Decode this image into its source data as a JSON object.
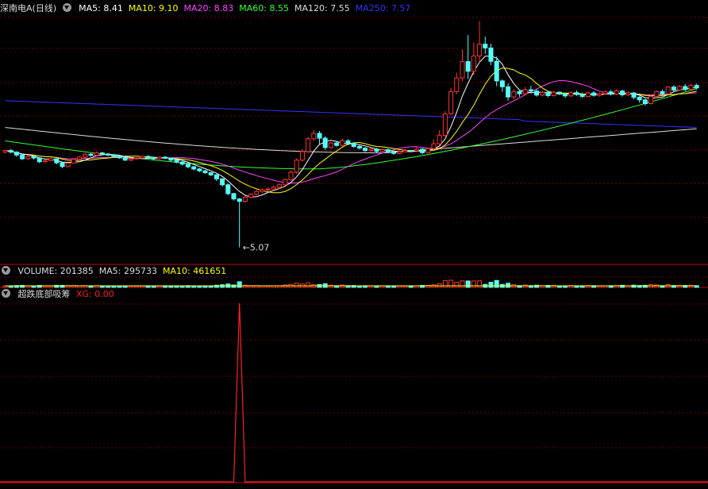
{
  "stock_title": "深南电A(日线)",
  "main_indicators": [
    {
      "label": "MA5: 8.41",
      "color": "#ffffff"
    },
    {
      "label": "MA10: 9.10",
      "color": "#ffff00"
    },
    {
      "label": "MA20: 8.83",
      "color": "#ff44ff"
    },
    {
      "label": "MA60: 8.55",
      "color": "#33ff33"
    },
    {
      "label": "MA120: 7.55",
      "color": "#dddddd"
    },
    {
      "label": "MA250: 7.57",
      "color": "#3333ff"
    }
  ],
  "low_marker": "←5.07",
  "volume_indicators": [
    {
      "label": "VOLUME: 201385",
      "color": "#dddddd"
    },
    {
      "label": "MA5: 295733",
      "color": "#dddddd"
    },
    {
      "label": "MA10: 461651",
      "color": "#ffff00"
    }
  ],
  "indicator_name": "超跌底部吸筹",
  "indicator_value": "XG: 0.00",
  "colors": {
    "up": "#ff3232",
    "down": "#54ffff",
    "grid": "#7a0000",
    "frame": "#c00000",
    "signal": "#ff2020"
  },
  "chart_data": {
    "type": "candlestick",
    "title": "",
    "candles": [
      [
        8.63,
        8.69,
        8.58,
        8.7
      ],
      [
        8.69,
        8.63,
        8.58,
        8.75
      ],
      [
        8.63,
        8.52,
        8.45,
        8.66
      ],
      [
        8.52,
        8.38,
        8.33,
        8.55
      ],
      [
        8.38,
        8.47,
        8.34,
        8.52
      ],
      [
        8.47,
        8.41,
        8.35,
        8.5
      ],
      [
        8.41,
        8.27,
        8.22,
        8.44
      ],
      [
        8.27,
        8.31,
        8.22,
        8.36
      ],
      [
        8.31,
        8.38,
        8.29,
        8.41
      ],
      [
        8.38,
        8.23,
        8.17,
        8.4
      ],
      [
        8.23,
        8.09,
        8.03,
        8.26
      ],
      [
        8.09,
        8.22,
        8.06,
        8.25
      ],
      [
        8.22,
        8.36,
        8.21,
        8.4
      ],
      [
        8.36,
        8.44,
        8.3,
        8.49
      ],
      [
        8.44,
        8.55,
        8.41,
        8.6
      ],
      [
        8.55,
        8.51,
        8.47,
        8.59
      ],
      [
        8.51,
        8.6,
        8.48,
        8.66
      ],
      [
        8.6,
        8.56,
        8.51,
        8.64
      ],
      [
        8.56,
        8.52,
        8.48,
        8.6
      ],
      [
        8.52,
        8.47,
        8.42,
        8.56
      ],
      [
        8.47,
        8.42,
        8.38,
        8.5
      ],
      [
        8.42,
        8.33,
        8.3,
        8.46
      ],
      [
        8.33,
        8.38,
        8.29,
        8.41
      ],
      [
        8.38,
        8.41,
        8.34,
        8.44
      ],
      [
        8.41,
        8.47,
        8.38,
        8.5
      ],
      [
        8.47,
        8.43,
        8.39,
        8.51
      ],
      [
        8.43,
        8.38,
        8.33,
        8.46
      ],
      [
        8.38,
        8.44,
        8.35,
        8.47
      ],
      [
        8.44,
        8.4,
        8.36,
        8.48
      ],
      [
        8.4,
        8.33,
        8.28,
        8.43
      ],
      [
        8.33,
        8.26,
        8.21,
        8.37
      ],
      [
        8.26,
        8.18,
        8.13,
        8.3
      ],
      [
        8.18,
        8.08,
        8.03,
        8.22
      ],
      [
        8.08,
        8.0,
        7.94,
        8.11
      ],
      [
        8.0,
        7.93,
        7.88,
        8.04
      ],
      [
        7.93,
        7.86,
        7.82,
        7.97
      ],
      [
        7.86,
        7.78,
        7.73,
        7.89
      ],
      [
        7.78,
        7.63,
        7.55,
        7.81
      ],
      [
        7.63,
        7.41,
        7.34,
        7.66
      ],
      [
        7.41,
        7.08,
        7.01,
        7.45
      ],
      [
        7.08,
        6.88,
        6.82,
        7.11
      ],
      [
        6.88,
        6.79,
        5.07,
        6.92
      ],
      [
        6.79,
        6.94,
        6.74,
        7.0
      ],
      [
        6.94,
        7.05,
        6.9,
        7.1
      ],
      [
        7.05,
        7.16,
        7.01,
        7.22
      ],
      [
        7.16,
        7.22,
        7.1,
        7.28
      ],
      [
        7.22,
        7.25,
        7.16,
        7.32
      ],
      [
        7.25,
        7.32,
        7.2,
        7.38
      ],
      [
        7.32,
        7.41,
        7.26,
        7.45
      ],
      [
        7.41,
        7.6,
        7.38,
        7.65
      ],
      [
        7.6,
        7.88,
        7.56,
        7.95
      ],
      [
        7.88,
        8.33,
        7.82,
        8.4
      ],
      [
        8.33,
        8.65,
        8.27,
        8.74
      ],
      [
        8.65,
        9.13,
        8.6,
        9.2
      ],
      [
        9.13,
        9.33,
        9.05,
        9.47
      ],
      [
        9.33,
        9.15,
        8.92,
        9.42
      ],
      [
        9.15,
        8.8,
        8.71,
        9.22
      ],
      [
        8.8,
        8.97,
        8.76,
        9.02
      ],
      [
        8.97,
        8.88,
        8.83,
        9.05
      ],
      [
        8.88,
        9.05,
        8.84,
        9.14
      ],
      [
        9.05,
        8.96,
        8.88,
        9.11
      ],
      [
        8.96,
        8.84,
        8.79,
        9.0
      ],
      [
        8.84,
        8.78,
        8.72,
        8.9
      ],
      [
        8.78,
        8.69,
        8.63,
        8.82
      ],
      [
        8.69,
        8.74,
        8.64,
        8.79
      ],
      [
        8.74,
        8.66,
        8.61,
        8.78
      ],
      [
        8.66,
        8.72,
        8.63,
        8.77
      ],
      [
        8.72,
        8.64,
        8.6,
        8.76
      ],
      [
        8.64,
        8.58,
        8.53,
        8.68
      ],
      [
        8.58,
        8.64,
        8.55,
        8.7
      ],
      [
        8.64,
        8.69,
        8.61,
        8.74
      ],
      [
        8.69,
        8.68,
        8.66,
        8.7
      ],
      [
        8.68,
        8.74,
        8.63,
        8.81
      ],
      [
        8.74,
        8.61,
        8.55,
        8.78
      ],
      [
        8.61,
        8.76,
        8.58,
        8.8
      ],
      [
        8.76,
        8.94,
        8.72,
        9.1
      ],
      [
        8.94,
        9.26,
        8.9,
        9.45
      ],
      [
        9.26,
        10.06,
        9.2,
        10.17
      ],
      [
        10.06,
        10.89,
        10.0,
        11.03
      ],
      [
        10.89,
        11.4,
        10.8,
        11.6
      ],
      [
        11.4,
        12.01,
        11.28,
        12.46
      ],
      [
        12.01,
        11.65,
        11.36,
        13.0
      ],
      [
        11.65,
        12.22,
        11.5,
        12.72
      ],
      [
        12.22,
        12.66,
        11.98,
        13.52
      ],
      [
        12.66,
        12.52,
        12.3,
        12.94
      ],
      [
        12.52,
        12.02,
        11.88,
        12.68
      ],
      [
        12.02,
        11.29,
        11.09,
        12.2
      ],
      [
        11.29,
        11.07,
        10.88,
        11.35
      ],
      [
        11.07,
        10.69,
        10.55,
        11.2
      ],
      [
        10.69,
        10.89,
        10.6,
        10.98
      ],
      [
        10.89,
        10.81,
        10.7,
        10.95
      ],
      [
        10.81,
        10.96,
        10.74,
        11.07
      ],
      [
        10.96,
        10.91,
        10.82,
        11.11
      ],
      [
        10.91,
        10.76,
        10.7,
        10.98
      ],
      [
        10.76,
        10.86,
        10.71,
        10.92
      ],
      [
        10.86,
        10.74,
        10.68,
        10.93
      ],
      [
        10.74,
        10.87,
        10.7,
        10.92
      ],
      [
        10.87,
        10.8,
        10.76,
        10.88
      ],
      [
        10.8,
        10.73,
        10.66,
        10.85
      ],
      [
        10.73,
        10.85,
        10.69,
        10.9
      ],
      [
        10.85,
        10.78,
        10.73,
        10.93
      ],
      [
        10.78,
        10.71,
        10.65,
        10.86
      ],
      [
        10.71,
        10.84,
        10.68,
        10.89
      ],
      [
        10.84,
        10.75,
        10.7,
        10.91
      ],
      [
        10.75,
        10.81,
        10.7,
        10.86
      ],
      [
        10.81,
        10.88,
        10.77,
        10.93
      ],
      [
        10.88,
        10.8,
        10.74,
        10.95
      ],
      [
        10.8,
        10.91,
        10.76,
        10.98
      ],
      [
        10.91,
        10.77,
        10.7,
        10.96
      ],
      [
        10.77,
        10.84,
        10.72,
        10.9
      ],
      [
        10.84,
        10.68,
        10.6,
        10.88
      ],
      [
        10.68,
        10.58,
        10.47,
        10.72
      ],
      [
        10.58,
        10.44,
        10.37,
        10.63
      ],
      [
        10.44,
        10.71,
        10.41,
        10.78
      ],
      [
        10.71,
        10.89,
        10.66,
        10.94
      ],
      [
        10.89,
        10.8,
        10.74,
        10.96
      ],
      [
        10.8,
        11.06,
        10.77,
        11.1
      ],
      [
        11.06,
        10.95,
        10.89,
        11.12
      ],
      [
        10.95,
        11.08,
        10.9,
        11.14
      ],
      [
        11.08,
        10.97,
        10.91,
        11.17
      ],
      [
        10.97,
        11.12,
        10.93,
        11.18
      ],
      [
        11.12,
        11.03,
        10.97,
        11.19
      ]
    ],
    "xg_values": [
      0,
      0,
      0,
      0,
      0,
      0,
      0,
      0,
      0,
      0,
      0,
      0,
      0,
      0,
      0,
      0,
      0,
      0,
      0,
      0,
      0,
      0,
      0,
      0,
      0,
      0,
      0,
      0,
      0,
      0,
      0,
      0,
      0,
      0,
      0,
      0,
      0,
      0,
      0,
      0,
      0,
      1,
      0,
      0,
      0,
      0,
      0,
      0,
      0,
      0,
      0,
      0,
      0,
      0,
      0,
      0,
      0,
      0,
      0,
      0,
      0,
      0,
      0,
      0,
      0,
      0,
      0,
      0,
      0,
      0,
      0,
      0,
      0,
      0,
      0,
      0,
      0,
      0,
      0,
      0,
      0,
      0,
      0,
      0,
      0,
      0,
      0,
      0,
      0,
      0,
      0,
      0,
      0,
      0,
      0,
      0,
      0,
      0,
      0,
      0,
      0,
      0,
      0,
      0,
      0,
      0,
      0,
      0,
      0,
      0,
      0,
      0,
      0,
      0,
      0,
      0,
      0,
      0,
      0,
      0,
      0,
      0,
      0
    ]
  }
}
